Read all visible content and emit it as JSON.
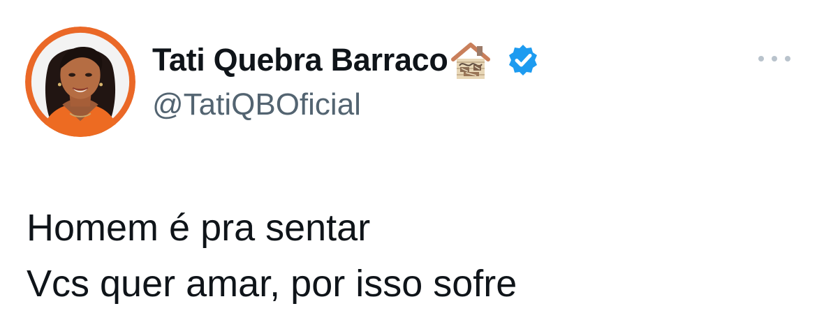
{
  "tweet": {
    "author": {
      "display_name": "Tati Quebra Barraco",
      "handle": "@TatiQBOficial",
      "name_emoji": "house-with-damage-icon",
      "verified_badge": "verified-badge-icon",
      "avatar_ring_color": "#ea6827",
      "verified_color": "#1d9bf0"
    },
    "more_icon": "more-options-icon",
    "text_lines": [
      "Homem é pra sentar",
      "Vcs quer amar, por isso sofre"
    ]
  }
}
